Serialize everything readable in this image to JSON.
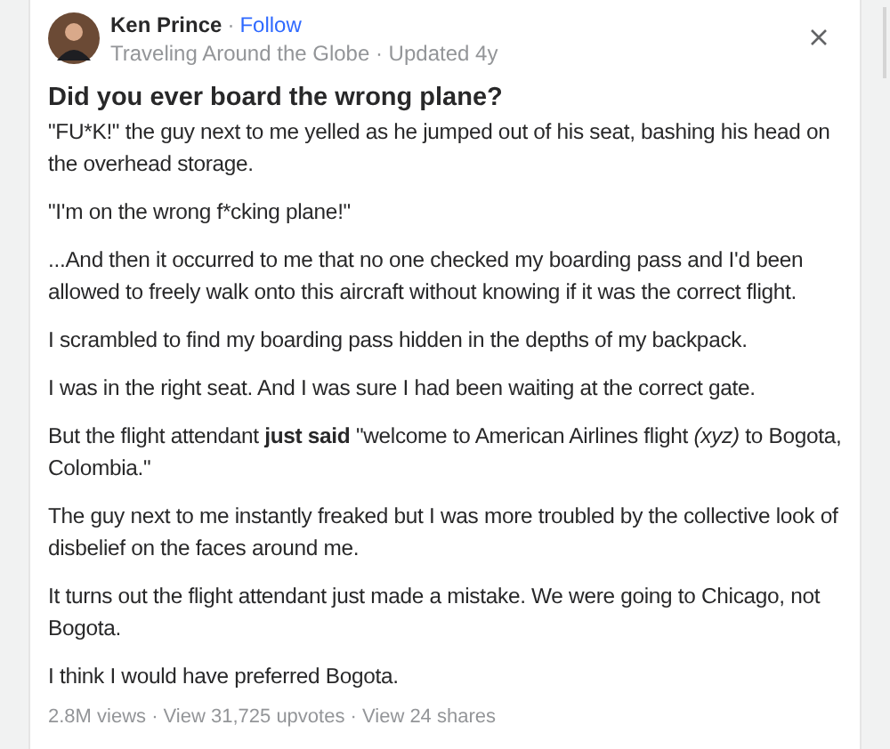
{
  "author": {
    "name": "Ken Prince",
    "separator": "·",
    "follow": "Follow",
    "subtitle": "Traveling Around the Globe · Updated 4y"
  },
  "question": "Did you ever board the wrong plane?",
  "paragraphs": [
    "\"FU*K!\" the guy next to me yelled as he jumped out of his seat, bashing his head on the overhead storage.",
    "\"I'm on the wrong f*cking plane!\"",
    "...And then it occurred to me that no one checked my boarding pass and I'd been allowed to freely walk onto this aircraft without knowing if it was the correct flight.",
    "I scrambled to find my boarding pass hidden in the depths of my backpack.",
    "I was in the right seat. And I was sure I had been waiting at the correct gate.",
    "But the flight attendant **just said** \"welcome to American Airlines flight *(xyz)* to Bogota, Colombia.\"",
    "The guy next to me instantly freaked but I was more troubled by the collective look of disbelief on the faces around me.",
    "It turns out the flight attendant just made a mistake. We were going to Chicago, not Bogota.",
    "I think I would have preferred Bogota."
  ],
  "stats": "2.8M views · View 31,725 upvotes · View 24 shares"
}
